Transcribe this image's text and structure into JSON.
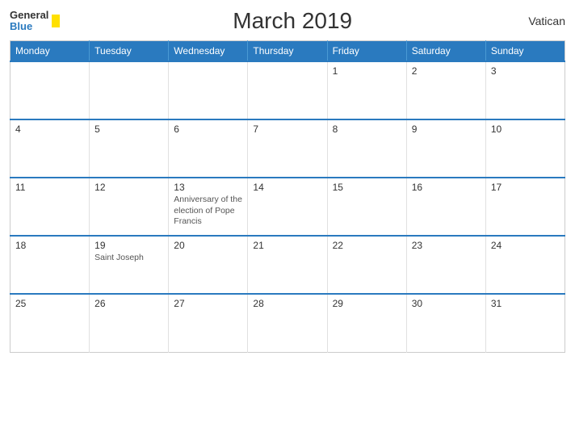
{
  "header": {
    "logo_general": "General",
    "logo_blue": "Blue",
    "title": "March 2019",
    "country": "Vatican"
  },
  "weekdays": [
    "Monday",
    "Tuesday",
    "Wednesday",
    "Thursday",
    "Friday",
    "Saturday",
    "Sunday"
  ],
  "weeks": [
    [
      {
        "day": "",
        "event": "",
        "empty": true
      },
      {
        "day": "",
        "event": "",
        "empty": true
      },
      {
        "day": "",
        "event": "",
        "empty": true
      },
      {
        "day": "",
        "event": "",
        "empty": true
      },
      {
        "day": "1",
        "event": ""
      },
      {
        "day": "2",
        "event": ""
      },
      {
        "day": "3",
        "event": ""
      }
    ],
    [
      {
        "day": "4",
        "event": ""
      },
      {
        "day": "5",
        "event": ""
      },
      {
        "day": "6",
        "event": ""
      },
      {
        "day": "7",
        "event": ""
      },
      {
        "day": "8",
        "event": ""
      },
      {
        "day": "9",
        "event": ""
      },
      {
        "day": "10",
        "event": ""
      }
    ],
    [
      {
        "day": "11",
        "event": ""
      },
      {
        "day": "12",
        "event": ""
      },
      {
        "day": "13",
        "event": "Anniversary of the election of Pope Francis"
      },
      {
        "day": "14",
        "event": ""
      },
      {
        "day": "15",
        "event": ""
      },
      {
        "day": "16",
        "event": ""
      },
      {
        "day": "17",
        "event": ""
      }
    ],
    [
      {
        "day": "18",
        "event": ""
      },
      {
        "day": "19",
        "event": "Saint Joseph"
      },
      {
        "day": "20",
        "event": ""
      },
      {
        "day": "21",
        "event": ""
      },
      {
        "day": "22",
        "event": ""
      },
      {
        "day": "23",
        "event": ""
      },
      {
        "day": "24",
        "event": ""
      }
    ],
    [
      {
        "day": "25",
        "event": ""
      },
      {
        "day": "26",
        "event": ""
      },
      {
        "day": "27",
        "event": ""
      },
      {
        "day": "28",
        "event": ""
      },
      {
        "day": "29",
        "event": ""
      },
      {
        "day": "30",
        "event": ""
      },
      {
        "day": "31",
        "event": ""
      }
    ]
  ]
}
